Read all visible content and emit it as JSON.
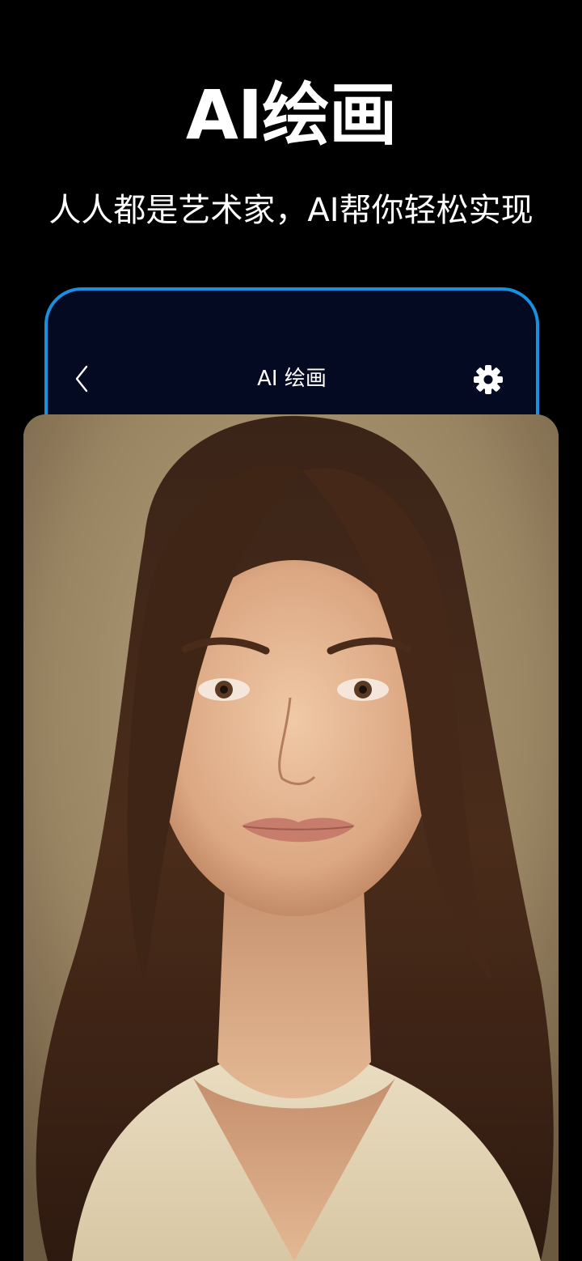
{
  "hero": {
    "title": "AI绘画",
    "subtitle": "人人都是艺术家，AI帮你轻松实现"
  },
  "app_bar": {
    "title": "AI 绘画",
    "back_icon": "chevron-left-icon",
    "settings_icon": "gear-icon"
  },
  "portrait": {
    "subject": "AI generated portrait of a woman with long brown hair"
  },
  "colors": {
    "background": "#000000",
    "frame_border": "#1a8fe0",
    "frame_fill": "#030a21",
    "text": "#ffffff"
  }
}
